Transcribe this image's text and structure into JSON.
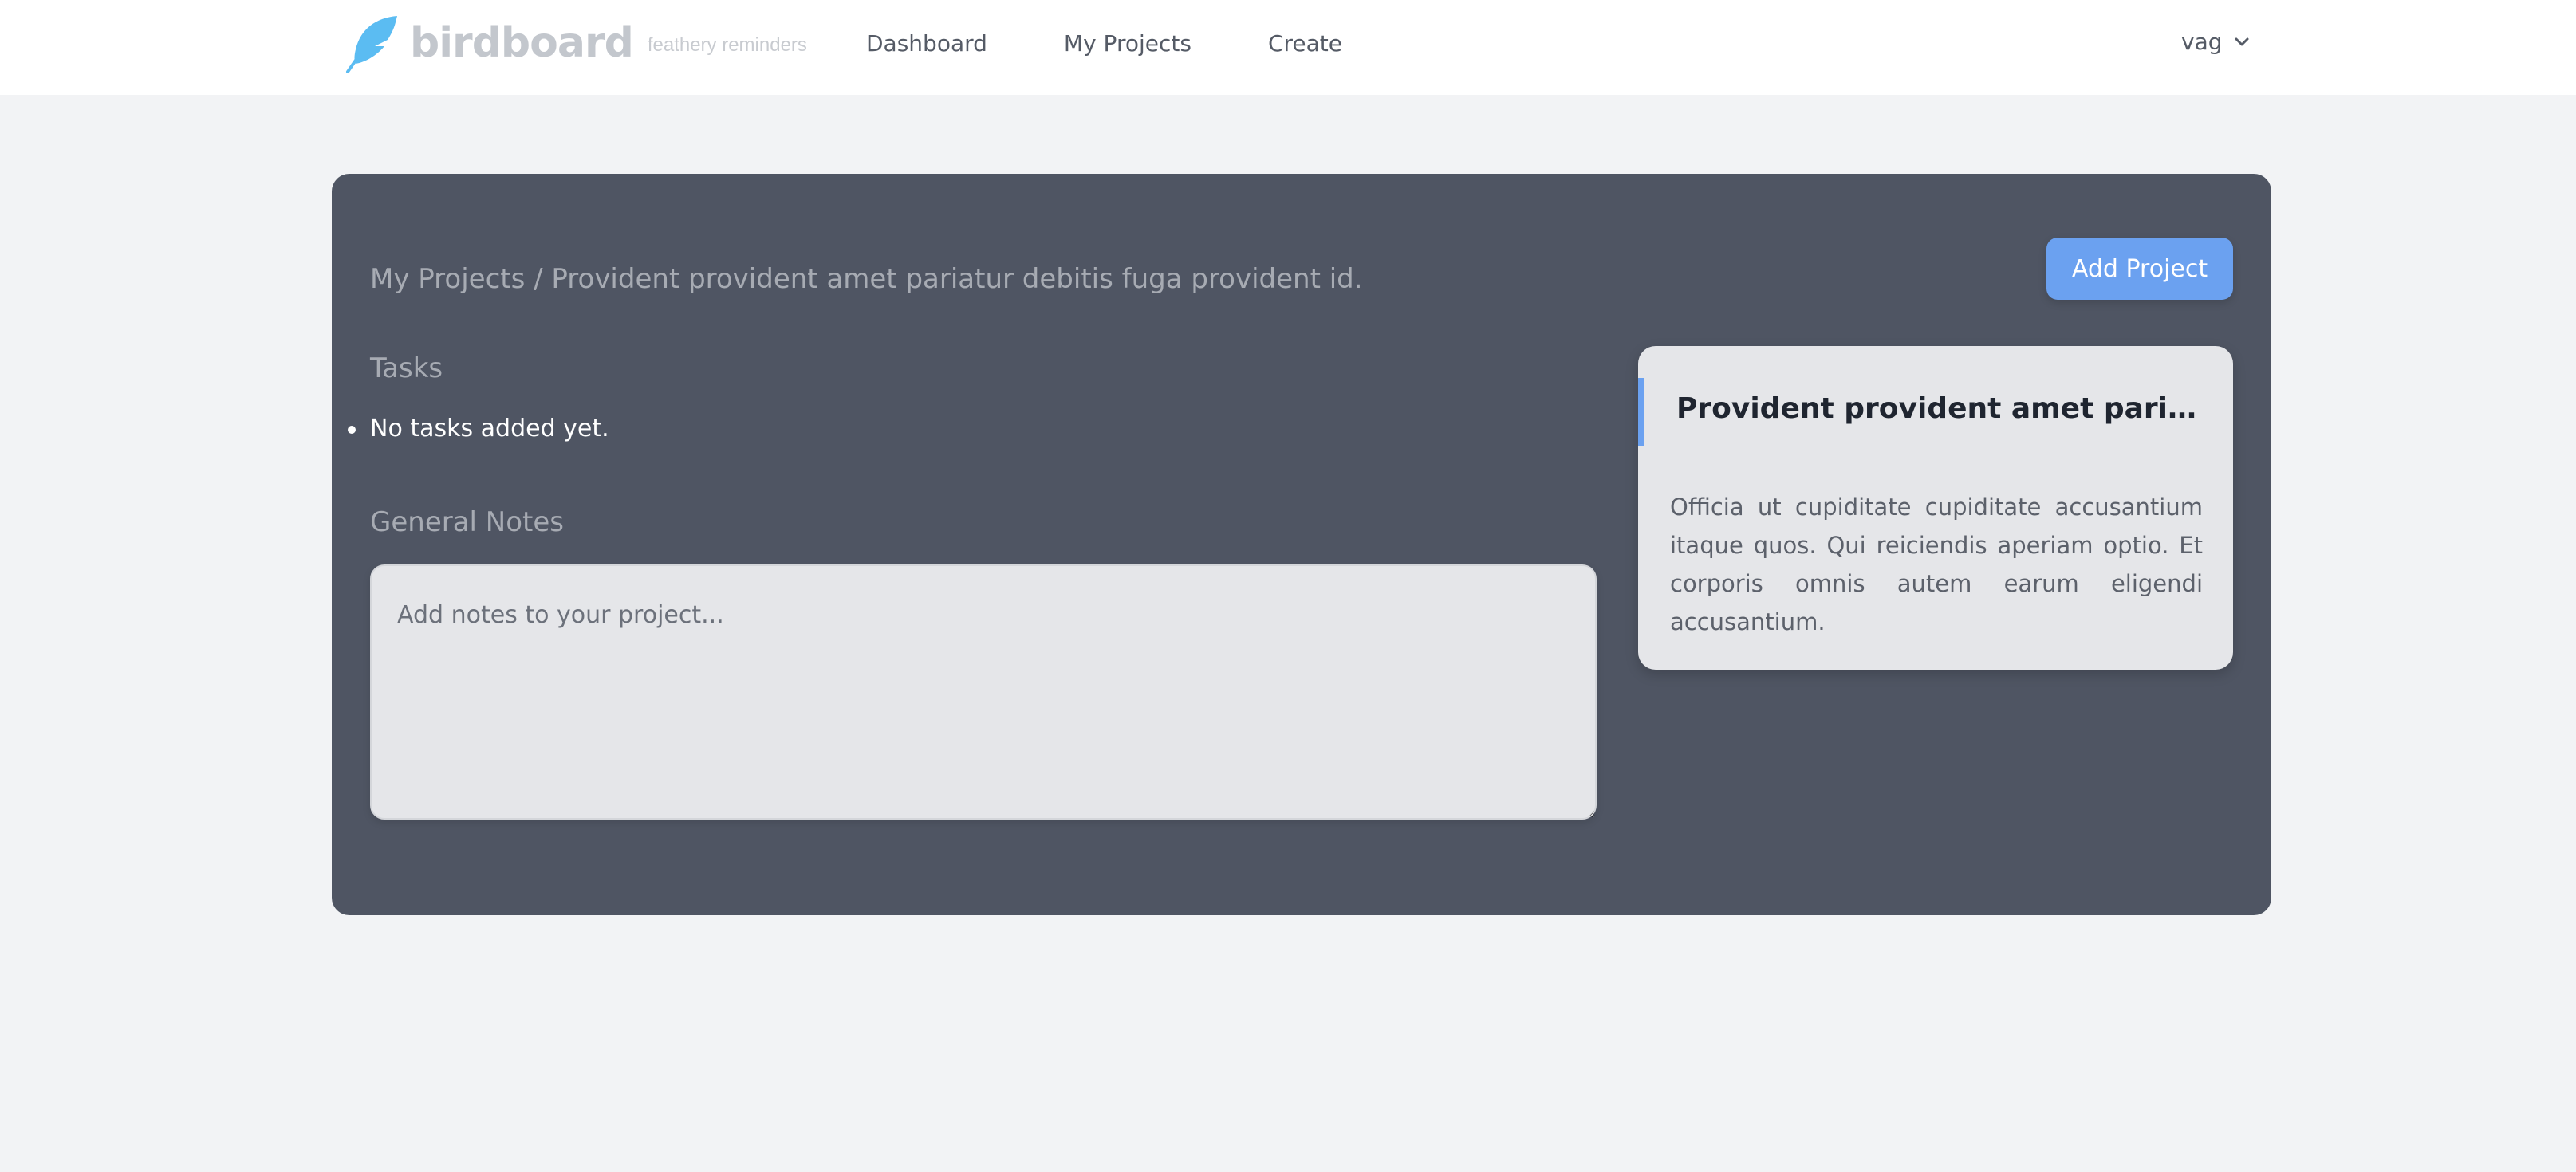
{
  "navbar": {
    "brand_name": "birdboard",
    "brand_tagline": "feathery reminders",
    "links": [
      "Dashboard",
      "My Projects",
      "Create"
    ],
    "user": "vag",
    "accent_color": "#6ba1f0"
  },
  "project": {
    "breadcrumb": "My Projects / Provident provident amet pariatur debitis fuga provident id.",
    "add_button_label": "Add Project",
    "tasks_heading": "Tasks",
    "tasks": [
      "No tasks added yet."
    ],
    "notes_heading": "General Notes",
    "notes_placeholder": "Add notes to your project...",
    "notes_value": ""
  },
  "preview": {
    "title": "Provident provident amet pariatur ...",
    "description": "Officia ut cupiditate cupiditate accusantium itaque quos. Qui reiciendis aperiam optio. Et corporis omnis autem earum eligendi accusantium."
  },
  "icons": {
    "logo": "feather-logo-icon",
    "user_menu": "chevron-down-icon"
  }
}
